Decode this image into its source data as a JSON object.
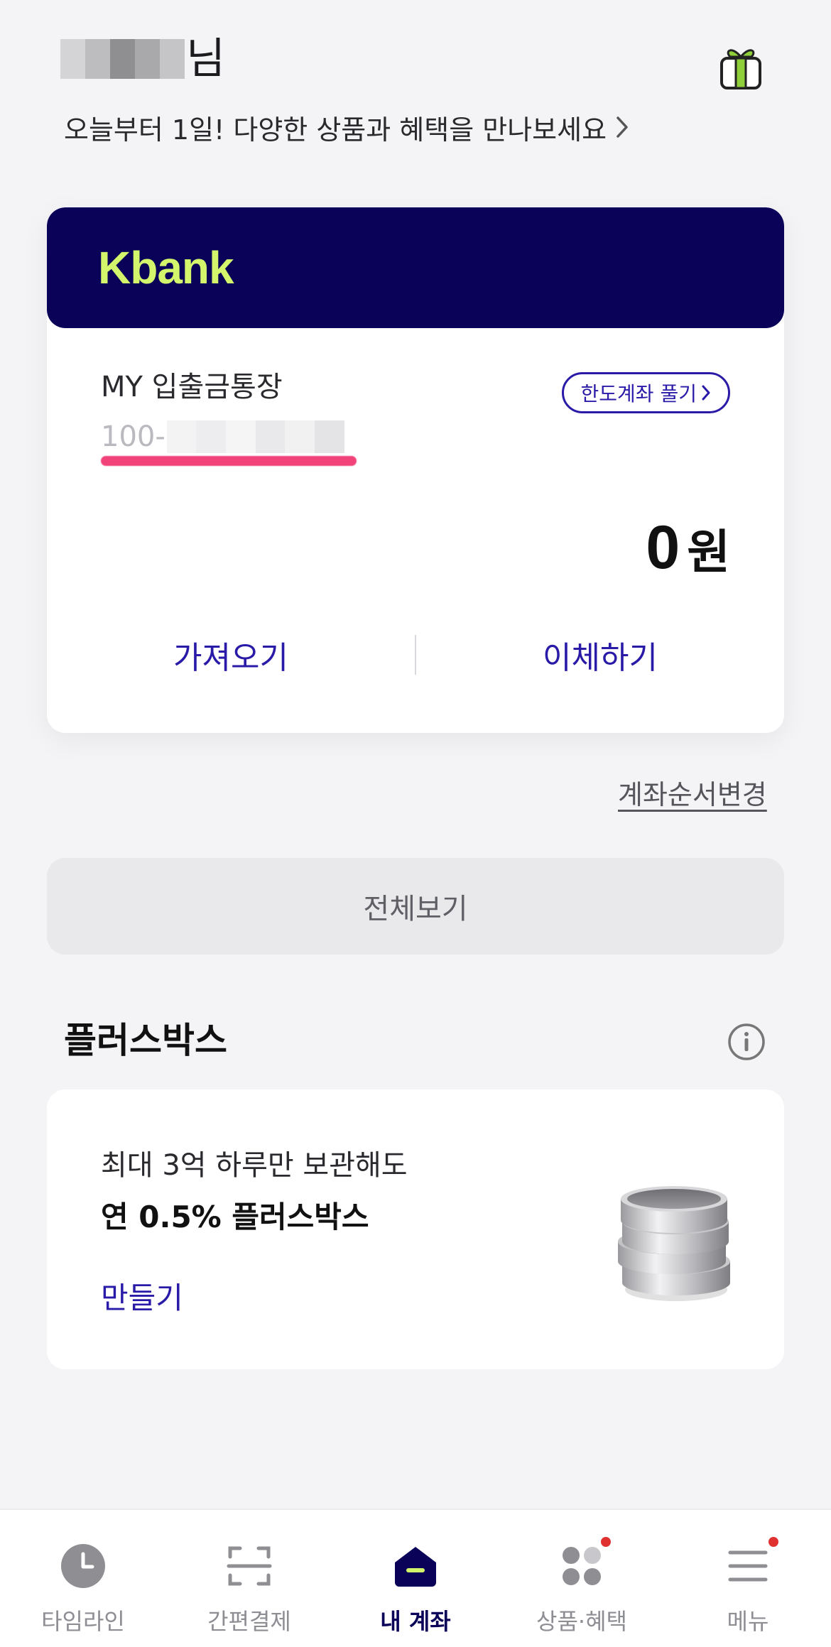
{
  "header": {
    "user_suffix": "님",
    "greeting": "오늘부터 1일! 다양한 상품과 혜택을 만나보세요",
    "gift_icon": "gift-icon"
  },
  "account_card": {
    "brand": "Kbank",
    "account_name": "MY 입출금통장",
    "account_number_prefix": "100-",
    "limit_button": "한도계좌 풀기",
    "balance_value": "0",
    "balance_unit": "원",
    "actions": [
      "가져오기",
      "이체하기"
    ],
    "colors": {
      "header_bg": "#0a0258",
      "brand": "#d3f56b",
      "accent": "#2a1aa8"
    }
  },
  "reorder_link": "계좌순서변경",
  "view_all": "전체보기",
  "plus_box": {
    "section_title": "플러스박스",
    "line1": "최대 3억 하루만 보관해도",
    "line2": "연 0.5% 플러스박스",
    "make_label": "만들기"
  },
  "tabbar": {
    "tabs": [
      {
        "label": "타임라인",
        "icon": "clock-icon",
        "active": false,
        "badge": false
      },
      {
        "label": "간편결제",
        "icon": "scan-icon",
        "active": false,
        "badge": false
      },
      {
        "label": "내 계좌",
        "icon": "home-icon",
        "active": true,
        "badge": false
      },
      {
        "label": "상품·혜택",
        "icon": "grid-dots-icon",
        "active": false,
        "badge": true
      },
      {
        "label": "메뉴",
        "icon": "menu-icon",
        "active": false,
        "badge": true
      }
    ]
  }
}
